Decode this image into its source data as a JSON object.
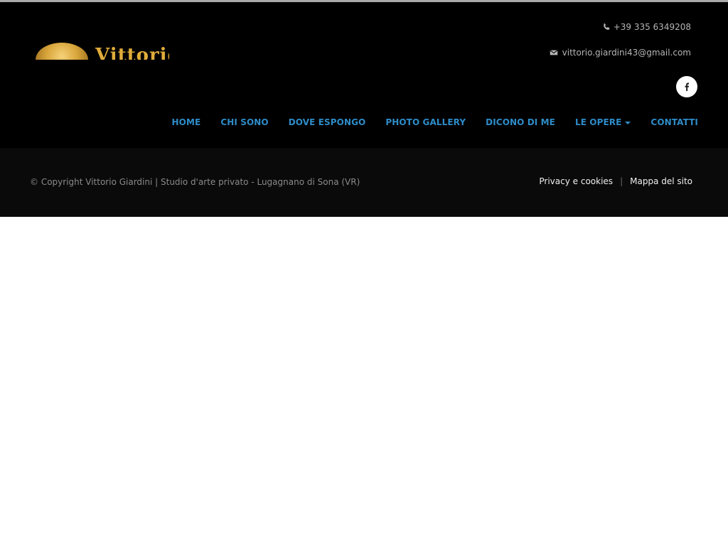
{
  "header": {
    "logo_text": "Vittorio",
    "phone": "+39 335 6349208",
    "email": "vittorio.giardini43@gmail.com",
    "social": [
      {
        "icon": "facebook-icon"
      }
    ]
  },
  "nav": {
    "items": [
      {
        "label": "HOME"
      },
      {
        "label": "CHI SONO"
      },
      {
        "label": "DOVE ESPONGO"
      },
      {
        "label": "PHOTO GALLERY"
      },
      {
        "label": "DICONO DI ME"
      },
      {
        "label": "LE OPERE",
        "has_dropdown": true
      },
      {
        "label": "CONTATTI"
      }
    ]
  },
  "footer": {
    "copyright": "© Copyright Vittorio Giardini | Studio d'arte privato - Lugagnano di Sona (VR)",
    "links": [
      {
        "label": "Privacy e cookies"
      },
      {
        "label": "Mappa del sito"
      }
    ],
    "separator": "|"
  },
  "colors": {
    "header_bg": "#000000",
    "footer_bg": "#0a0a0a",
    "nav_link": "#2e8cc8",
    "logo_gold": "#e0ac3a"
  }
}
